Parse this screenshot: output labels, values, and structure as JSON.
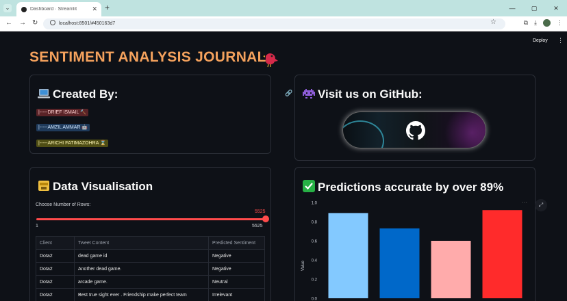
{
  "browser": {
    "tab_title": "Dashboard · Streamlit",
    "close": "✕",
    "new_tab": "+",
    "url": "localhost:8501/#450163d7",
    "win_controls": [
      "—",
      "▢",
      "✕"
    ]
  },
  "app": {
    "deploy_label": "Deploy",
    "menu_icon": "⋮",
    "title": "SENTIMENT ANALYSIS JOURNAL",
    "created_by": {
      "heading": "Created By:",
      "authors": [
        "|-----DRIEF ISMAIL 🔨",
        "|-----AMZIL AMMAR 🤖",
        "|-----ARICHI FATIMAZOHRA ⌛"
      ]
    },
    "github": {
      "heading": "Visit us on GitHub:"
    },
    "data_vis": {
      "heading": "Data Visualisation",
      "slider_label": "Choose Number of Rows:",
      "slider_value": "5525",
      "slider_min": "1",
      "slider_max": "5525",
      "slider_fraction": 1.0,
      "columns": [
        "Client",
        "Tweet Content",
        "Predicted Sentiment"
      ],
      "rows": [
        [
          "Dota2",
          "dead game id",
          "Negative"
        ],
        [
          "Dota2",
          "Another dead game.",
          "Negative"
        ],
        [
          "Dota2",
          "arcade game.",
          "Neutral"
        ],
        [
          "Dota2",
          "Best true sight ever . Friendship make perfect team",
          "Irrelevant"
        ]
      ]
    },
    "predictions": {
      "heading": "Predictions accurate by over 89%"
    }
  },
  "chart_data": {
    "type": "bar",
    "categories": [
      "",
      "",
      "",
      ""
    ],
    "values": [
      0.89,
      0.73,
      0.6,
      0.92
    ],
    "colors": [
      "#83c9ff",
      "#0068c9",
      "#ffabab",
      "#ff2b2b"
    ],
    "ylabel": "Value",
    "ylim": [
      0,
      1.0
    ],
    "yticks": [
      "0.0",
      "0.2",
      "0.4",
      "0.6",
      "0.8",
      "1.0"
    ],
    "grid": false
  }
}
